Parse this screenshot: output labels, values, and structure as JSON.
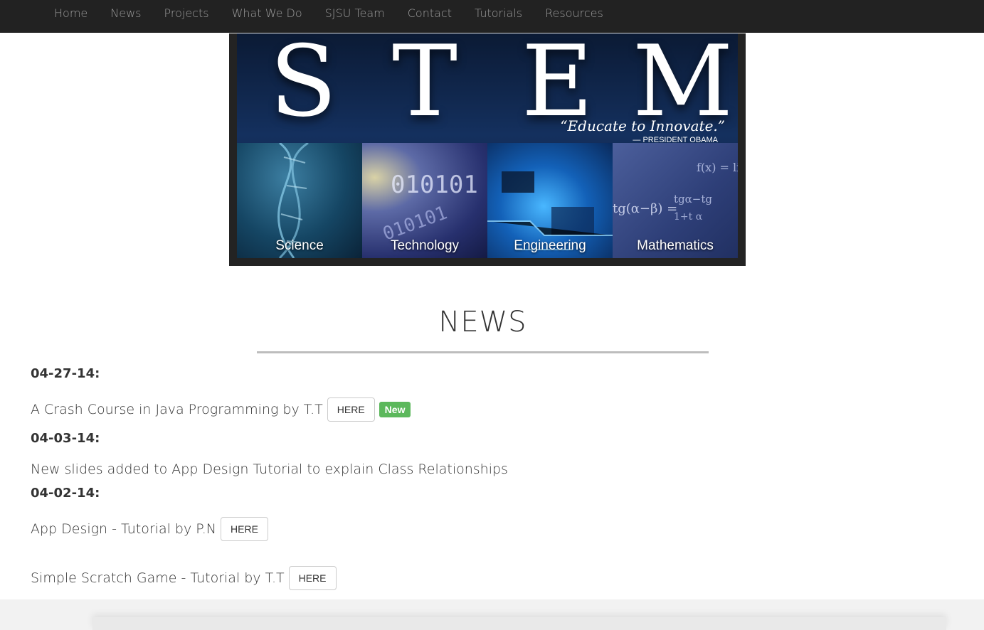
{
  "nav": {
    "items": [
      "Home",
      "News",
      "Projects",
      "What We Do",
      "SJSU Team",
      "Contact",
      "Tutorials",
      "Resources"
    ]
  },
  "banner": {
    "letters": [
      "S",
      "T",
      "E",
      "M"
    ],
    "quote": "“Educate to Innovate.”",
    "quote_author": "— PRESIDENT OBAMA",
    "panels": [
      "Science",
      "Technology",
      "Engineering",
      "Mathematics"
    ],
    "math_text": [
      "f(x) = li",
      "tg(α−β) =",
      "tgα−tg",
      "1+t α"
    ],
    "tech_text": "010101",
    "colors": {
      "navbar": "#222222",
      "nav_text": "#9d9d9d",
      "badge": "#5cb85c"
    }
  },
  "news": {
    "title": "NEWS",
    "entries": [
      {
        "date": "04-27-14:",
        "text": "A Crash Course in Java Programming by T.T",
        "button": "HERE",
        "badge": "New"
      },
      {
        "date": "04-03-14:",
        "text": "New slides added to App Design Tutorial to explain Class Relationships"
      },
      {
        "date": "04-02-14:",
        "text": "App Design - Tutorial by P.N",
        "button": "HERE"
      },
      {
        "text": "Simple Scratch Game - Tutorial by T.T",
        "button": "HERE"
      }
    ]
  }
}
